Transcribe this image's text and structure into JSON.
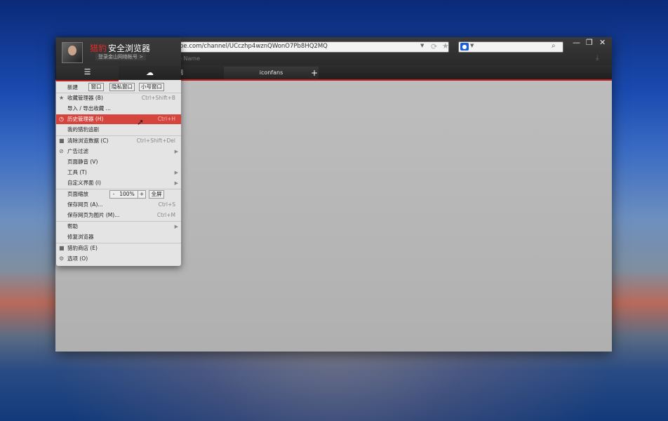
{
  "browser": {
    "address_url": "be.com/channel/UCczhp4wznQWonO7Pb8HQ2MQ",
    "bookmark_bar_text": "e Name",
    "tabs": [
      {
        "label": "网"
      },
      {
        "label": "iconfans"
      }
    ],
    "new_tab_label": "+",
    "window_buttons": {
      "minimize": "—",
      "maximize": "❐",
      "close": "✕"
    }
  },
  "menu": {
    "brand_red": "猎豹",
    "brand_white": "安全浏览器",
    "login_link": "登录金山网络帐号 >",
    "new_label": "新建",
    "new_window_buttons": [
      "窗口",
      "隐私窗口",
      "小号窗口"
    ],
    "items": [
      {
        "label": "收藏管理器 (B)",
        "shortcut": "Ctrl+Shift+B",
        "icon": "star-icon"
      },
      {
        "label": "导入 / 导出收藏 ...",
        "shortcut": ""
      },
      {
        "label": "历史管理器 (H)",
        "shortcut": "Ctrl+H",
        "icon": "clock-icon",
        "active": true
      },
      {
        "label": "我的猎豹追剧",
        "shortcut": ""
      },
      {
        "label": "清除浏览数据 (C)",
        "shortcut": "Ctrl+Shift+Del",
        "icon": "clear-icon"
      },
      {
        "label": "广告过滤",
        "submenu": true,
        "icon": "ad-block-icon"
      },
      {
        "label": "页面静音 (V)",
        "shortcut": ""
      },
      {
        "label": "工具 (T)",
        "submenu": true
      },
      {
        "label": "自定义界面 (I)",
        "submenu": true
      },
      {
        "label": "页面缩放",
        "zoom": "100%",
        "zoom_minus": "-",
        "zoom_plus": "+",
        "fullscreen": "全屏"
      },
      {
        "label": "保存网页 (A)...",
        "shortcut": "Ctrl+S"
      },
      {
        "label": "保存网页为图片 (M)...",
        "shortcut": "Ctrl+M"
      },
      {
        "label": "帮助",
        "submenu": true
      },
      {
        "label": "修复浏览器",
        "shortcut": ""
      },
      {
        "label": "猎豹商店 (E)",
        "icon": "store-icon"
      },
      {
        "label": "选项 (O)",
        "icon": "gear-icon"
      }
    ]
  }
}
